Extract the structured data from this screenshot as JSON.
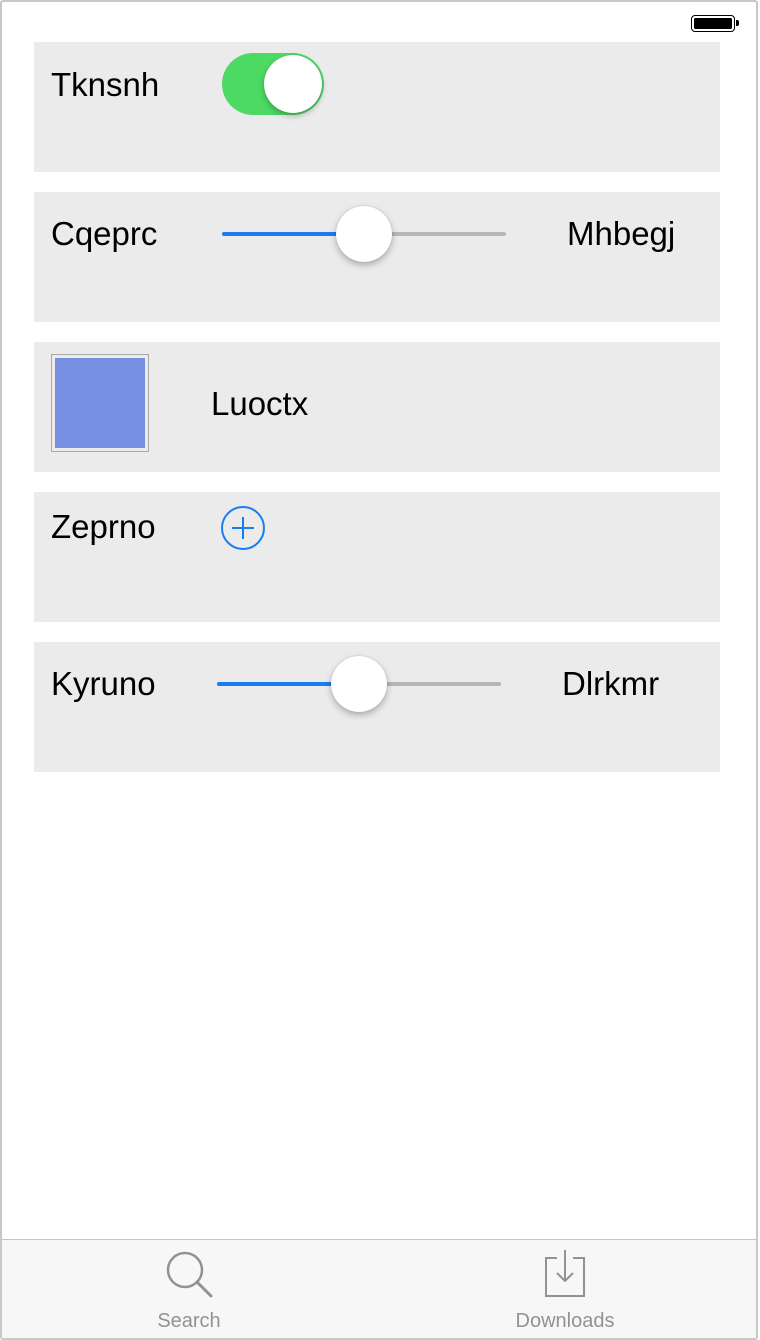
{
  "status_bar": {
    "battery_level": 1.0
  },
  "rows": {
    "toggle_row": {
      "label": "Tknsnh",
      "toggle_on": true,
      "toggle_color": "#4cd964"
    },
    "slider_row_1": {
      "label": "Cqeprc",
      "value_fraction": 0.5,
      "right_label": "Mhbegj"
    },
    "color_row": {
      "swatch_color": "#7890e4",
      "label": "Luoctx"
    },
    "add_row": {
      "label": "Zeprno",
      "icon": "plus-circle-icon"
    },
    "slider_row_2": {
      "label": "Kyruno",
      "value_fraction": 0.5,
      "right_label": "Dlrkmr"
    }
  },
  "colors": {
    "accent": "#1a7cf2",
    "row_background": "#ebebeb",
    "track_inactive": "#b6b6b6"
  },
  "tabbar": {
    "tabs": [
      {
        "label": "Search",
        "icon": "search-icon"
      },
      {
        "label": "Downloads",
        "icon": "download-tray-icon"
      }
    ]
  }
}
